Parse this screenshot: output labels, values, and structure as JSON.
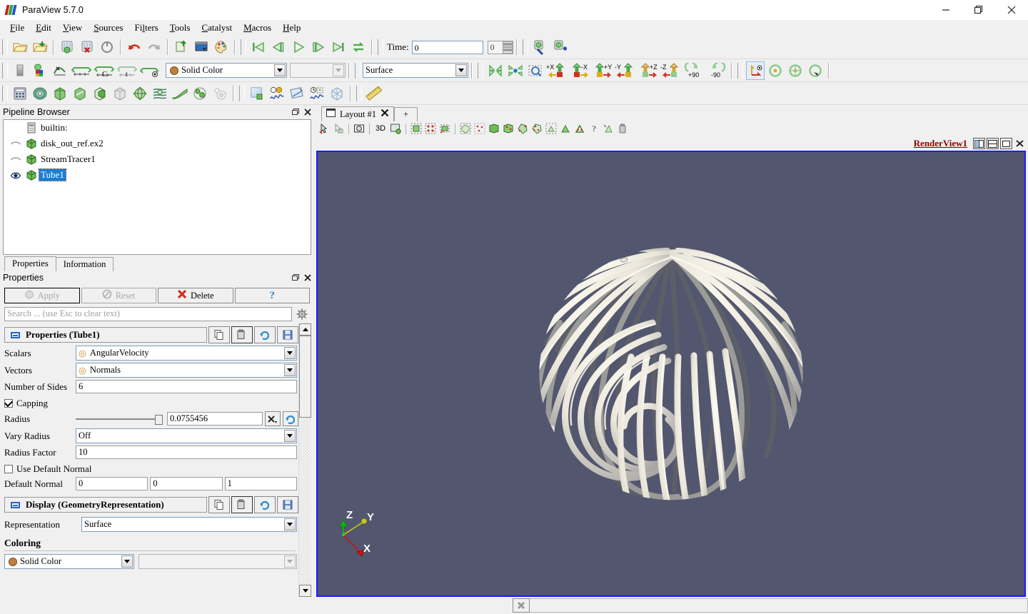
{
  "window": {
    "title": "ParaView 5.7.0",
    "minimize": "minimize-icon",
    "maximize": "restore-icon",
    "close": "close-icon"
  },
  "menubar": {
    "items": [
      {
        "label": "File",
        "mnemonic": "F"
      },
      {
        "label": "Edit",
        "mnemonic": "E"
      },
      {
        "label": "View",
        "mnemonic": "V"
      },
      {
        "label": "Sources",
        "mnemonic": "S"
      },
      {
        "label": "Filters",
        "mnemonic": "l"
      },
      {
        "label": "Tools",
        "mnemonic": "T"
      },
      {
        "label": "Catalyst",
        "mnemonic": "C"
      },
      {
        "label": "Macros",
        "mnemonic": "M"
      },
      {
        "label": "Help",
        "mnemonic": "H"
      }
    ]
  },
  "toolbar_main": {
    "buttons": [
      "open-file-icon",
      "open-recent-icon",
      "save-state-icon",
      "load-state-icon",
      "reset-session-icon",
      "undo-icon",
      "redo-icon",
      "connect-server-icon",
      "screenshot-icon",
      "color-palette-icon"
    ],
    "vcr": [
      "first-frame-icon",
      "previous-frame-icon",
      "play-icon",
      "next-frame-icon",
      "last-frame-icon",
      "loop-icon"
    ],
    "time_label": "Time:",
    "time_value": "0",
    "frame_value": "0",
    "macro_buttons": [
      "edit-macros-icon",
      "add-macro-icon"
    ]
  },
  "toolbar_repr": {
    "buttons": [
      "scalar-bar-icon",
      "edit-color-map-icon",
      "rescale-custom-icon",
      "rescale-data-range-icon",
      "rescale-over-time-icon",
      "rescale-temporal-icon",
      "rescale-visible-icon"
    ],
    "coloring_field": "Solid Color",
    "component_field": "",
    "representation_field": "Surface",
    "camera_buttons": [
      "reset-camera-icon",
      "zoom-to-data-icon",
      "zoom-to-box-icon",
      "plus-x-icon",
      "minus-x-icon",
      "plus-y-icon",
      "minus-y-icon",
      "plus-z-icon",
      "minus-z-icon",
      "rotate-plus-90-icon",
      "rotate-minus-90-icon"
    ],
    "axis_buttons": [
      "show-center-axes-icon",
      "reset-center-icon",
      "pick-center-icon",
      "rotate-center-icon"
    ]
  },
  "toolbar_filters": {
    "buttons": [
      "calculator-icon",
      "contour-icon",
      "clip-icon",
      "slice-icon",
      "threshold-icon",
      "extract-subset-icon",
      "glyph-icon",
      "stream-tracer-icon",
      "warp-icon",
      "group-datasets-icon",
      "extract-level-icon"
    ],
    "data_buttons": [
      "plot-over-data-icon",
      "plot-over-line-icon",
      "plot-selection-icon",
      "plot-data-over-time-icon",
      "extract-block-icon"
    ],
    "measure_buttons": [
      "ruler-icon"
    ]
  },
  "pipeline": {
    "title": "Pipeline Browser",
    "float_icon": "undock-icon",
    "close_icon": "close-icon",
    "items": [
      {
        "label": "builtin:",
        "icon": "server-icon",
        "visible": null,
        "selected": false,
        "indent": 0
      },
      {
        "label": "disk_out_ref.ex2",
        "icon": "dataset-icon",
        "visible": false,
        "selected": false,
        "indent": 1
      },
      {
        "label": "StreamTracer1",
        "icon": "dataset-icon",
        "visible": false,
        "selected": false,
        "indent": 1
      },
      {
        "label": "Tube1",
        "icon": "dataset-icon",
        "visible": true,
        "selected": true,
        "indent": 1
      }
    ]
  },
  "panel_tabs": [
    {
      "label": "Properties",
      "active": true
    },
    {
      "label": "Information",
      "active": false
    }
  ],
  "properties_dock": {
    "title": "Properties",
    "float_icon": "undock-icon",
    "close_icon": "close-icon",
    "buttons": [
      {
        "label": "Apply",
        "icon": "apply-icon",
        "enabled": false
      },
      {
        "label": "Reset",
        "icon": "reset-icon",
        "enabled": false
      },
      {
        "label": "Delete",
        "icon": "delete-icon",
        "enabled": true
      },
      {
        "label": "?",
        "icon": "help-icon",
        "enabled": true
      }
    ],
    "search_placeholder": "Search ... (use Esc to clear text)",
    "gear_icon": "gear-icon"
  },
  "properties_section": {
    "title": "Properties (Tube1)",
    "header_buttons": [
      "copy-icon",
      "paste-icon",
      "restore-defaults-icon",
      "save-defaults-icon"
    ],
    "fields": [
      {
        "label": "Scalars",
        "type": "combo",
        "value": "AngularVelocity",
        "bullet": true
      },
      {
        "label": "Vectors",
        "type": "combo",
        "value": "Normals",
        "bullet": true
      },
      {
        "label": "Number of Sides",
        "type": "text",
        "value": "6"
      },
      {
        "label": "Capping",
        "type": "checkbox",
        "checked": true
      },
      {
        "label": "Radius",
        "type": "slider-text",
        "value": "0.0755456"
      },
      {
        "label": "Vary Radius",
        "type": "combo",
        "value": "Off"
      },
      {
        "label": "Radius Factor",
        "type": "text",
        "value": "10"
      },
      {
        "label": "Use Default Normal",
        "type": "checkbox",
        "checked": false
      },
      {
        "label": "Default Normal",
        "type": "vector3",
        "values": [
          "0",
          "0",
          "1"
        ]
      }
    ],
    "radius_clear_icon": "clear-icon",
    "radius_reset_icon": "reset-range-icon"
  },
  "display_section": {
    "title": "Display (GeometryRepresentation)",
    "header_buttons": [
      "copy-icon",
      "paste-icon",
      "restore-defaults-icon",
      "save-defaults-icon"
    ],
    "representation_label": "Representation",
    "representation_value": "Surface",
    "coloring_label": "Coloring",
    "coloring_value": "Solid Color",
    "coloring_component": ""
  },
  "layout": {
    "tab_label": "Layout #1",
    "tab_icon": "layout-icon",
    "tab_close_icon": "close-icon",
    "add_tab_label": "+"
  },
  "view_toolbar": {
    "buttons": [
      "interact-icon",
      "select-cells-icon",
      "camera-icon",
      "3D",
      "3d-render-icon",
      "select-cells-on-icon",
      "select-points-on-icon",
      "select-frustum-cells-icon",
      "select-block-icon",
      "interactive-select-icon",
      "hover-cells-icon",
      "hover-points-icon",
      "select-polygon-cells-icon",
      "select-polygon-points-icon",
      "select-all-icon",
      "plot-selection-icon",
      "freeze-selection-icon",
      "help-selection-icon",
      "select-custom-icon",
      "clear-selection-icon"
    ],
    "label_3d": "3D"
  },
  "view_header": {
    "name": "RenderView1",
    "split_horizontal_icon": "split-horizontal-icon",
    "split_vertical_icon": "split-vertical-icon",
    "maximize_icon": "maximize-icon",
    "close_icon": "close-icon"
  },
  "render_view": {
    "background_color": "#52566e",
    "object": "stream-tracer-tubes-sphere",
    "tube_color_light": "#f2efe6",
    "tube_color_dark": "#5e6068",
    "axes": [
      {
        "label": "X",
        "color": "#dd1111"
      },
      {
        "label": "Y",
        "color": "#cccc22"
      },
      {
        "label": "Z",
        "color": "#11bb11"
      }
    ]
  },
  "statusbar": {
    "cancel_icon": "cancel-icon",
    "progress_text": ""
  }
}
